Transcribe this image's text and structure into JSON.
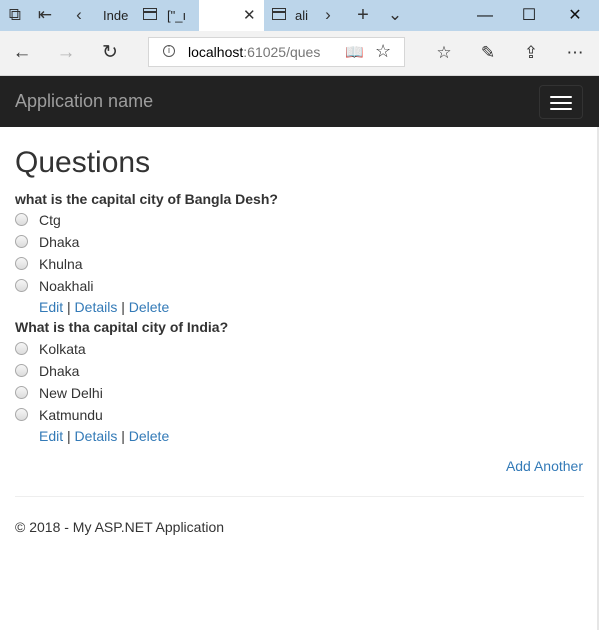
{
  "browser": {
    "tabs": [
      {
        "label": "Inde"
      },
      {
        "label": "[\"_ı"
      },
      {
        "label": ""
      },
      {
        "label": "ali"
      }
    ],
    "url_host": "localhost",
    "url_rest": ":61025/ques"
  },
  "app": {
    "brand": "Application name",
    "title": "Questions",
    "questions": [
      {
        "text": "what is the capital city of Bangla Desh?",
        "options": [
          "Ctg",
          "Dhaka",
          "Khulna",
          "Noakhali"
        ]
      },
      {
        "text": "What is tha capital city of India?",
        "options": [
          "Kolkata",
          "Dhaka",
          "New Delhi",
          "Katmundu"
        ]
      }
    ],
    "links": {
      "edit": "Edit",
      "details": "Details",
      "delete": "Delete",
      "separator": "|"
    },
    "add_another": "Add Another",
    "footer": "© 2018 - My ASP.NET Application"
  }
}
